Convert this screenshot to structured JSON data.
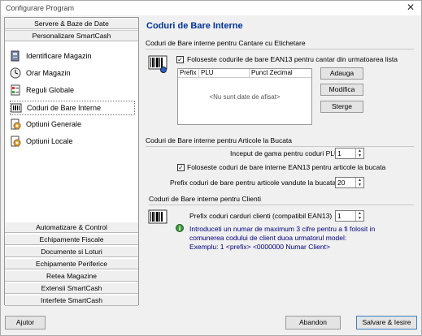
{
  "window": {
    "title": "Configurare Program",
    "close_glyph": "✕"
  },
  "nav": {
    "top_buttons": [
      "Servere & Baze de Date",
      "Personalizare SmartCash"
    ],
    "items": [
      {
        "label": "Identificare Magazin",
        "icon": "id-card-icon"
      },
      {
        "label": "Orar Magazin",
        "icon": "clock-icon"
      },
      {
        "label": "Reguli Globale",
        "icon": "rules-icon"
      },
      {
        "label": "Coduri de Bare Interne",
        "icon": "barcode-icon"
      },
      {
        "label": "Optiuni Generale",
        "icon": "options-icon"
      },
      {
        "label": "Optiuni Locale",
        "icon": "local-options-icon"
      }
    ],
    "bottom_buttons": [
      "Automatizare & Control",
      "Echipamente Fiscale",
      "Documente si Loturi",
      "Echipamente Periferice",
      "Retea Magazine",
      "Extensii SmartCash",
      "Interfete SmartCash"
    ]
  },
  "page": {
    "title": "Coduri de Bare Interne",
    "section1": {
      "title": "Coduri de Bare interne pentru Cantare cu Etichetare",
      "checkbox": "Foloseste codurile de bare EAN13 pentru cantar din urmatoarea lista",
      "checked": true,
      "columns": [
        "Prefix",
        "PLU",
        "Punct Zecimal"
      ],
      "empty_text": "<Nu sunt date de afisat>",
      "buttons": [
        "Adauga",
        "Modifica",
        "Sterge"
      ]
    },
    "section2": {
      "title": "Coduri de Bare interne pentru Articole la Bucata",
      "range_label": "Inceput de gama pentru coduri PLU",
      "range_value": "1",
      "checkbox": "Foloseste coduri de bare interne EAN13 pentru articole la bucata",
      "checked": true,
      "prefix_label": "Prefix coduri de bare pentru articole vandute la bucata",
      "prefix_value": "20"
    },
    "section3": {
      "title": "Coduri de Bare interne pentru Clienti",
      "prefix_label": "Prefix coduri carduri clienti (compatibil EAN13)",
      "prefix_value": "1",
      "info_lines": [
        "Introduceti un numar de maximum 3 cifre pentru a fi folosit in",
        "comunerea codului de client duoa urmatorul model:",
        "Exemplu: 1 <prefix> <0000000 Numar Client>"
      ]
    }
  },
  "footer": {
    "help": "Ajutor",
    "cancel": "Abandon",
    "save": "Salvare & Iesire"
  }
}
